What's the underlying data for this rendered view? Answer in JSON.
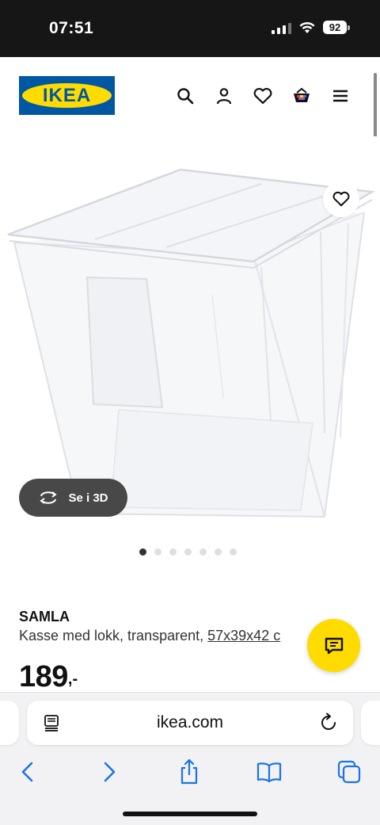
{
  "status_bar": {
    "time": "07:51",
    "battery": "92"
  },
  "header": {
    "logo_text": "IKEA",
    "icons": [
      "search-icon",
      "account-icon",
      "favorites-icon",
      "basket-icon",
      "menu-icon"
    ]
  },
  "gallery": {
    "view_3d_label": "Se i 3D",
    "image_count": 7,
    "active_image_index": 0
  },
  "product": {
    "name": "SAMLA",
    "description": "Kasse med lokk, transparent, ",
    "dimensions": "57x39x42 c",
    "price": "189",
    "price_suffix": ",-"
  },
  "browser": {
    "url": "ikea.com"
  },
  "colors": {
    "ikea_blue": "#0058a3",
    "ikea_yellow": "#ffdb00",
    "ios_blue": "#1a73e8",
    "pill_dark": "#484848"
  }
}
